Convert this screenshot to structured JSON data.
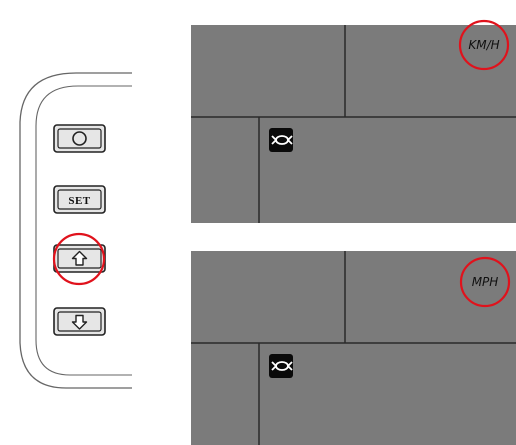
{
  "colors": {
    "screen_fill": "#7b7b7b",
    "screen_divider": "#2a2a2a",
    "bezel_stroke": "#666666",
    "button_fill": "#e6e6e6",
    "button_stroke": "#222222",
    "highlight_ring": "#e0121c",
    "icon_fill": "#0a0a0a",
    "icon_glyph": "#ffffff"
  },
  "button_panel": {
    "buttons": [
      {
        "id": "power",
        "icon": "circle-icon"
      },
      {
        "id": "set",
        "label": "SET"
      },
      {
        "id": "up",
        "icon": "arrow-up-icon"
      },
      {
        "id": "down",
        "icon": "arrow-down-icon"
      }
    ],
    "highlighted_button": "up"
  },
  "displays": [
    {
      "unit": "KM/H",
      "icon": "fish-eye-icon",
      "highlighted": true
    },
    {
      "unit": "MPH",
      "icon": "fish-eye-icon",
      "highlighted": true
    }
  ]
}
